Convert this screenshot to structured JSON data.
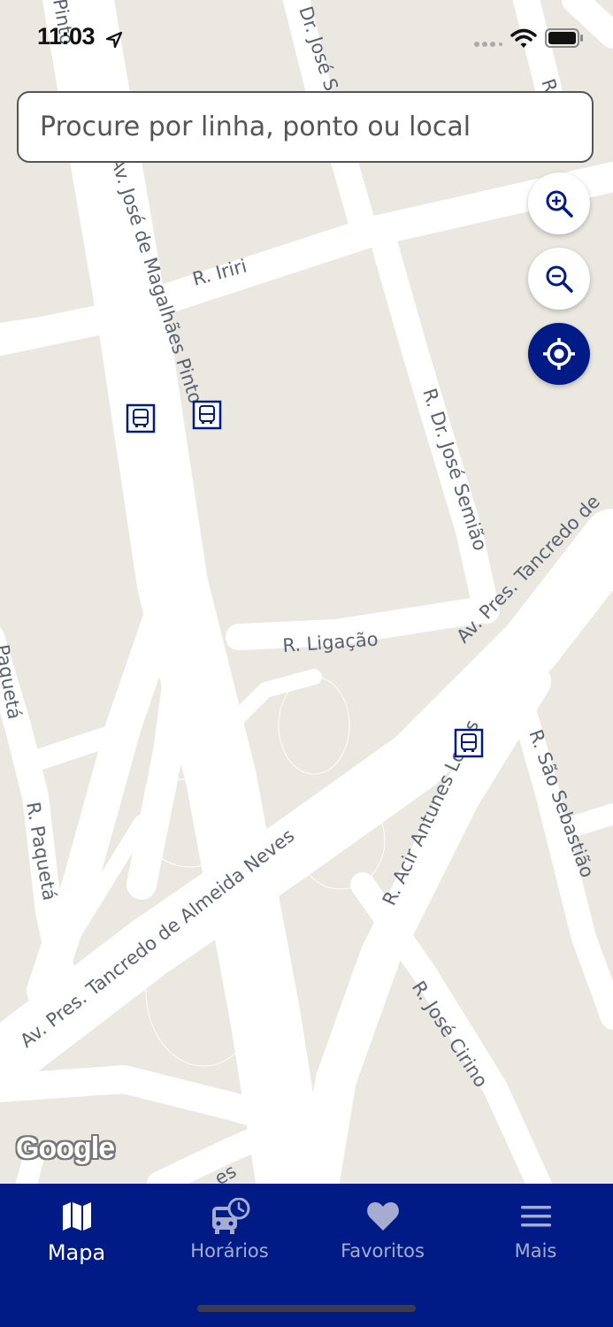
{
  "status_bar": {
    "time": "11:03",
    "icons": [
      "location-arrow-icon",
      "signal-dots-icon",
      "wifi-icon",
      "battery-icon"
    ]
  },
  "search": {
    "placeholder": "Procure por linha, ponto ou local",
    "value": ""
  },
  "map": {
    "attribution": "Google",
    "controls": [
      "zoom-in-icon",
      "zoom-out-icon",
      "my-location-icon"
    ],
    "colors": {
      "land": "#ebe8e1",
      "road": "#ffffff",
      "road_label": "#5a6170",
      "bus_stop": "#001a86",
      "brand": "#001a86"
    },
    "road_labels": {
      "r1": "R. Iriri",
      "r2": "Av. José de Magalhães Pinto",
      "r3": "R. Dr. José Semião",
      "r4": "R. Ligação",
      "r5": "Av. Pres. Tancredo de",
      "r6": "Av. Pres. Tancredo de Almeida Neves",
      "r7": "R. Acir Antunes Lopes",
      "r8": "R. São Sebastião",
      "r9": "R. Paquetá",
      "r10": "R. José Cirino",
      "r11": "Dr. José S",
      "r12": "Pinto",
      "r13": "Paquetá",
      "r14": "es",
      "r15": "R"
    },
    "bus_stop_icon": "bus-stop-icon"
  },
  "tabbar": {
    "active": "Mapa",
    "tabs": [
      {
        "label": "Mapa",
        "icon": "map-icon"
      },
      {
        "label": "Horários",
        "icon": "bus-clock-icon"
      },
      {
        "label": "Favoritos",
        "icon": "heart-icon"
      },
      {
        "label": "Mais",
        "icon": "menu-icon"
      }
    ]
  }
}
